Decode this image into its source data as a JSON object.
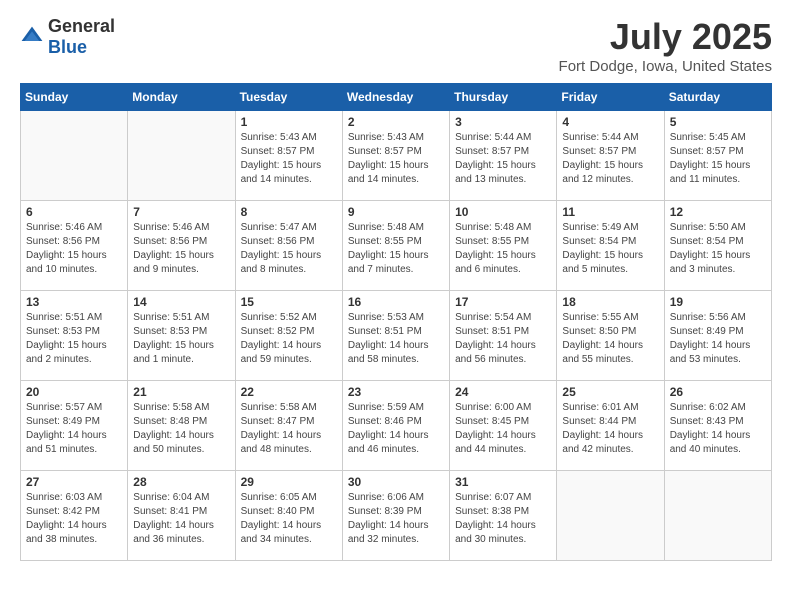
{
  "logo": {
    "text_general": "General",
    "text_blue": "Blue"
  },
  "title": "July 2025",
  "subtitle": "Fort Dodge, Iowa, United States",
  "days_of_week": [
    "Sunday",
    "Monday",
    "Tuesday",
    "Wednesday",
    "Thursday",
    "Friday",
    "Saturday"
  ],
  "weeks": [
    [
      {
        "day": "",
        "sunrise": "",
        "sunset": "",
        "daylight": ""
      },
      {
        "day": "",
        "sunrise": "",
        "sunset": "",
        "daylight": ""
      },
      {
        "day": "1",
        "sunrise": "Sunrise: 5:43 AM",
        "sunset": "Sunset: 8:57 PM",
        "daylight": "Daylight: 15 hours and 14 minutes."
      },
      {
        "day": "2",
        "sunrise": "Sunrise: 5:43 AM",
        "sunset": "Sunset: 8:57 PM",
        "daylight": "Daylight: 15 hours and 14 minutes."
      },
      {
        "day": "3",
        "sunrise": "Sunrise: 5:44 AM",
        "sunset": "Sunset: 8:57 PM",
        "daylight": "Daylight: 15 hours and 13 minutes."
      },
      {
        "day": "4",
        "sunrise": "Sunrise: 5:44 AM",
        "sunset": "Sunset: 8:57 PM",
        "daylight": "Daylight: 15 hours and 12 minutes."
      },
      {
        "day": "5",
        "sunrise": "Sunrise: 5:45 AM",
        "sunset": "Sunset: 8:57 PM",
        "daylight": "Daylight: 15 hours and 11 minutes."
      }
    ],
    [
      {
        "day": "6",
        "sunrise": "Sunrise: 5:46 AM",
        "sunset": "Sunset: 8:56 PM",
        "daylight": "Daylight: 15 hours and 10 minutes."
      },
      {
        "day": "7",
        "sunrise": "Sunrise: 5:46 AM",
        "sunset": "Sunset: 8:56 PM",
        "daylight": "Daylight: 15 hours and 9 minutes."
      },
      {
        "day": "8",
        "sunrise": "Sunrise: 5:47 AM",
        "sunset": "Sunset: 8:56 PM",
        "daylight": "Daylight: 15 hours and 8 minutes."
      },
      {
        "day": "9",
        "sunrise": "Sunrise: 5:48 AM",
        "sunset": "Sunset: 8:55 PM",
        "daylight": "Daylight: 15 hours and 7 minutes."
      },
      {
        "day": "10",
        "sunrise": "Sunrise: 5:48 AM",
        "sunset": "Sunset: 8:55 PM",
        "daylight": "Daylight: 15 hours and 6 minutes."
      },
      {
        "day": "11",
        "sunrise": "Sunrise: 5:49 AM",
        "sunset": "Sunset: 8:54 PM",
        "daylight": "Daylight: 15 hours and 5 minutes."
      },
      {
        "day": "12",
        "sunrise": "Sunrise: 5:50 AM",
        "sunset": "Sunset: 8:54 PM",
        "daylight": "Daylight: 15 hours and 3 minutes."
      }
    ],
    [
      {
        "day": "13",
        "sunrise": "Sunrise: 5:51 AM",
        "sunset": "Sunset: 8:53 PM",
        "daylight": "Daylight: 15 hours and 2 minutes."
      },
      {
        "day": "14",
        "sunrise": "Sunrise: 5:51 AM",
        "sunset": "Sunset: 8:53 PM",
        "daylight": "Daylight: 15 hours and 1 minute."
      },
      {
        "day": "15",
        "sunrise": "Sunrise: 5:52 AM",
        "sunset": "Sunset: 8:52 PM",
        "daylight": "Daylight: 14 hours and 59 minutes."
      },
      {
        "day": "16",
        "sunrise": "Sunrise: 5:53 AM",
        "sunset": "Sunset: 8:51 PM",
        "daylight": "Daylight: 14 hours and 58 minutes."
      },
      {
        "day": "17",
        "sunrise": "Sunrise: 5:54 AM",
        "sunset": "Sunset: 8:51 PM",
        "daylight": "Daylight: 14 hours and 56 minutes."
      },
      {
        "day": "18",
        "sunrise": "Sunrise: 5:55 AM",
        "sunset": "Sunset: 8:50 PM",
        "daylight": "Daylight: 14 hours and 55 minutes."
      },
      {
        "day": "19",
        "sunrise": "Sunrise: 5:56 AM",
        "sunset": "Sunset: 8:49 PM",
        "daylight": "Daylight: 14 hours and 53 minutes."
      }
    ],
    [
      {
        "day": "20",
        "sunrise": "Sunrise: 5:57 AM",
        "sunset": "Sunset: 8:49 PM",
        "daylight": "Daylight: 14 hours and 51 minutes."
      },
      {
        "day": "21",
        "sunrise": "Sunrise: 5:58 AM",
        "sunset": "Sunset: 8:48 PM",
        "daylight": "Daylight: 14 hours and 50 minutes."
      },
      {
        "day": "22",
        "sunrise": "Sunrise: 5:58 AM",
        "sunset": "Sunset: 8:47 PM",
        "daylight": "Daylight: 14 hours and 48 minutes."
      },
      {
        "day": "23",
        "sunrise": "Sunrise: 5:59 AM",
        "sunset": "Sunset: 8:46 PM",
        "daylight": "Daylight: 14 hours and 46 minutes."
      },
      {
        "day": "24",
        "sunrise": "Sunrise: 6:00 AM",
        "sunset": "Sunset: 8:45 PM",
        "daylight": "Daylight: 14 hours and 44 minutes."
      },
      {
        "day": "25",
        "sunrise": "Sunrise: 6:01 AM",
        "sunset": "Sunset: 8:44 PM",
        "daylight": "Daylight: 14 hours and 42 minutes."
      },
      {
        "day": "26",
        "sunrise": "Sunrise: 6:02 AM",
        "sunset": "Sunset: 8:43 PM",
        "daylight": "Daylight: 14 hours and 40 minutes."
      }
    ],
    [
      {
        "day": "27",
        "sunrise": "Sunrise: 6:03 AM",
        "sunset": "Sunset: 8:42 PM",
        "daylight": "Daylight: 14 hours and 38 minutes."
      },
      {
        "day": "28",
        "sunrise": "Sunrise: 6:04 AM",
        "sunset": "Sunset: 8:41 PM",
        "daylight": "Daylight: 14 hours and 36 minutes."
      },
      {
        "day": "29",
        "sunrise": "Sunrise: 6:05 AM",
        "sunset": "Sunset: 8:40 PM",
        "daylight": "Daylight: 14 hours and 34 minutes."
      },
      {
        "day": "30",
        "sunrise": "Sunrise: 6:06 AM",
        "sunset": "Sunset: 8:39 PM",
        "daylight": "Daylight: 14 hours and 32 minutes."
      },
      {
        "day": "31",
        "sunrise": "Sunrise: 6:07 AM",
        "sunset": "Sunset: 8:38 PM",
        "daylight": "Daylight: 14 hours and 30 minutes."
      },
      {
        "day": "",
        "sunrise": "",
        "sunset": "",
        "daylight": ""
      },
      {
        "day": "",
        "sunrise": "",
        "sunset": "",
        "daylight": ""
      }
    ]
  ]
}
